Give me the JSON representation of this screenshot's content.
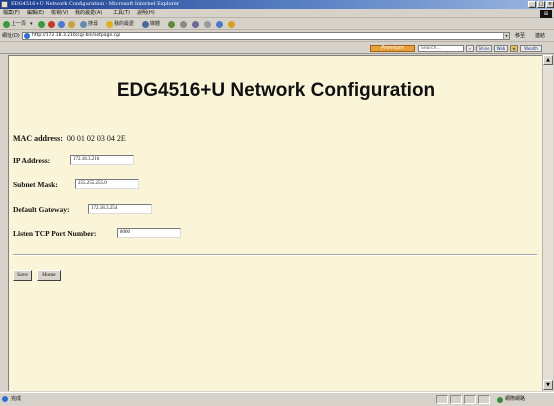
{
  "window": {
    "title": "EDG4516+U Network Configuration - Microsoft Internet Explorer",
    "controls": [
      "_",
      "□",
      "×"
    ]
  },
  "menubar": {
    "items": [
      "檔案(F)",
      "編輯(E)",
      "檢視(V)",
      "我的最愛(A)",
      "工具(T)",
      "說明(H)"
    ]
  },
  "toolbar": {
    "back_label": "上一頁",
    "search_label": "搜尋",
    "favorites_label": "我的最愛",
    "media_label": "媒體"
  },
  "addressbar": {
    "label": "網址(D)",
    "url": "http://172.18.3.216/cgi-bin/setpage.cgi",
    "go_label": "移至",
    "links_label": "連結"
  },
  "searchbar": {
    "premium_label": "Premium",
    "search_placeholder": "Search...",
    "buttons": [
      "Shine",
      "Web",
      "Wealth"
    ]
  },
  "page": {
    "heading": "EDG4516+U Network Configuration",
    "mac_label": "MAC address:",
    "mac_value": "00 01 02 03 04 2E",
    "fields": {
      "ip_label": "IP Address:",
      "ip_value": "172.18.3.216",
      "subnet_label": "Subnet Mask:",
      "subnet_value": "255.255.255.0",
      "gateway_label": "Default Gateway:",
      "gateway_value": "172.18.3.254",
      "port_label": "Listen TCP Port Number:",
      "port_value": "8000"
    },
    "save_label": "Save",
    "home_label": "Home"
  },
  "statusbar": {
    "status_text": "完成",
    "zone_text": "網際網路"
  },
  "colors": {
    "page_background": "#faf4d8",
    "titlebar": "#1b3d8f",
    "premium": "#e7a13a"
  }
}
